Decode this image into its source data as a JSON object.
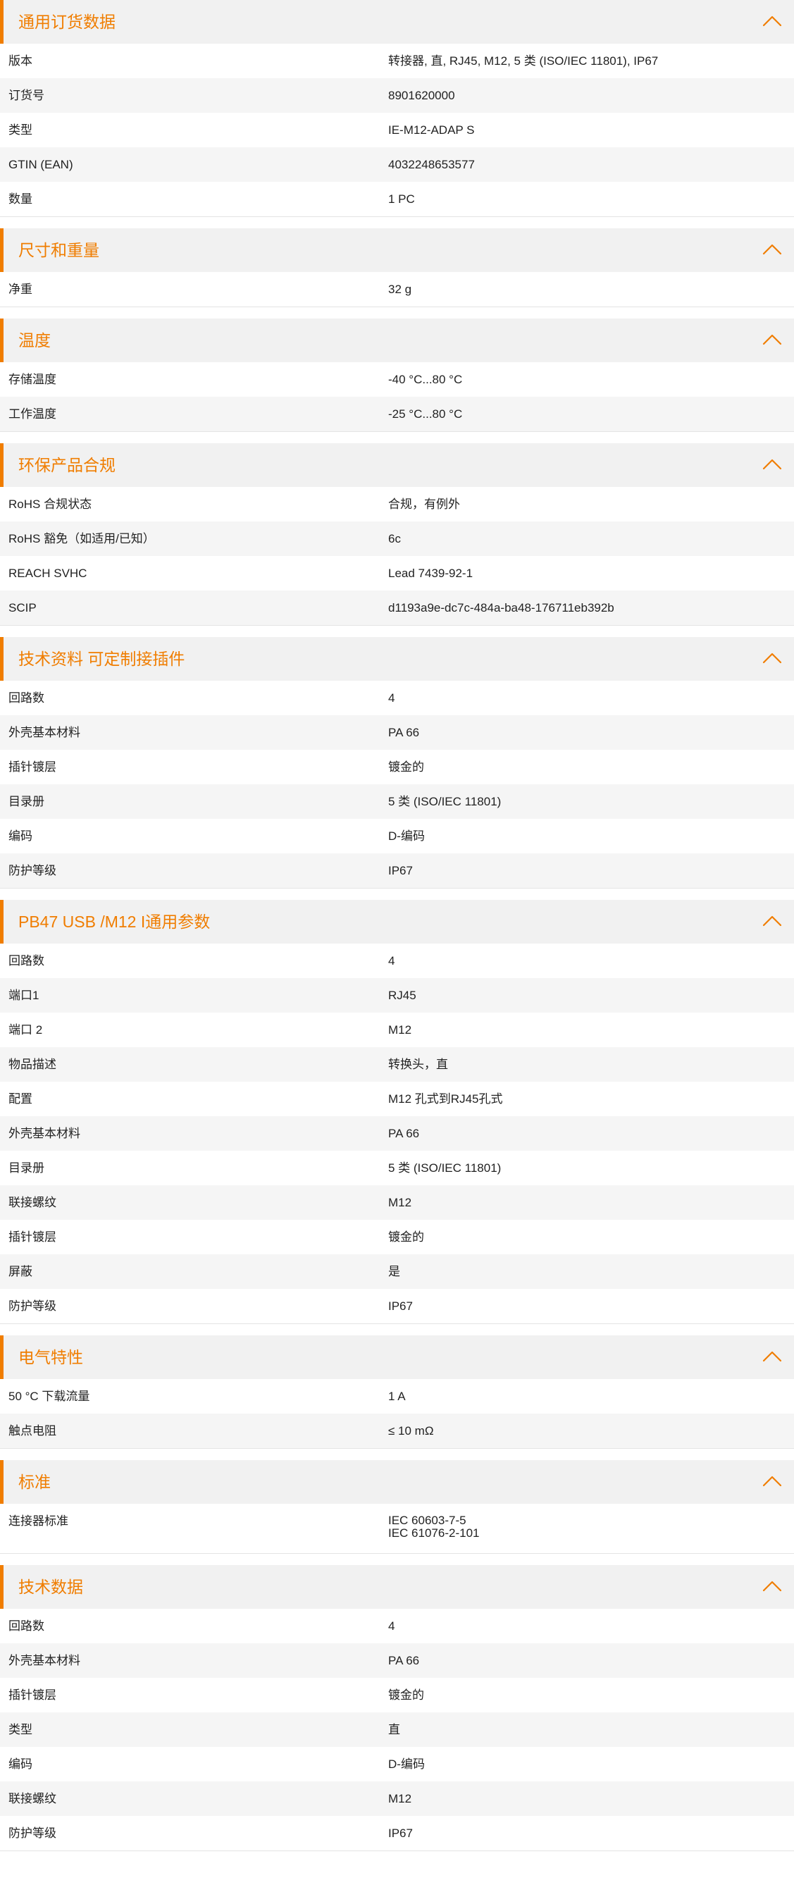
{
  "theme": {
    "accent": "#f07d00",
    "header_bg": "#f1f1f1",
    "row_alt_bg": "#f5f5f5"
  },
  "icons": {
    "collapse": "chevron-up-icon"
  },
  "sections": [
    {
      "title": "通用订货数据",
      "rows": [
        {
          "label": "版本",
          "value": "转接器, 直, RJ45, M12, 5 类 (ISO/IEC 11801), IP67"
        },
        {
          "label": "订货号",
          "value": "8901620000"
        },
        {
          "label": "类型",
          "value": "IE-M12-ADAP S"
        },
        {
          "label": "GTIN (EAN)",
          "value": "4032248653577"
        },
        {
          "label": "数量",
          "value": "1  PC"
        }
      ]
    },
    {
      "title": "尺寸和重量",
      "rows": [
        {
          "label": "净重",
          "value": "32  g"
        }
      ]
    },
    {
      "title": "温度",
      "rows": [
        {
          "label": "存储温度",
          "value": "-40 °C...80 °C"
        },
        {
          "label": "工作温度",
          "value": "-25 °C...80 °C"
        }
      ]
    },
    {
      "title": "环保产品合规",
      "rows": [
        {
          "label": "RoHS 合规状态",
          "value": "合规，有例外"
        },
        {
          "label": "RoHS 豁免（如适用/已知）",
          "value": "6c"
        },
        {
          "label": "REACH SVHC",
          "value": "Lead 7439-92-1"
        },
        {
          "label": "SCIP",
          "value": "d1193a9e-dc7c-484a-ba48-176711eb392b"
        }
      ]
    },
    {
      "title": "技术资料 可定制接插件",
      "rows": [
        {
          "label": "回路数",
          "value": "4"
        },
        {
          "label": "外壳基本材料",
          "value": "PA 66"
        },
        {
          "label": "插针镀层",
          "value": "镀金的"
        },
        {
          "label": "目录册",
          "value": "5 类 (ISO/IEC 11801)"
        },
        {
          "label": "编码",
          "value": "D-编码"
        },
        {
          "label": "防护等级",
          "value": "IP67"
        }
      ]
    },
    {
      "title": "PB47 USB /M12 I通用参数",
      "rows": [
        {
          "label": "回路数",
          "value": "4"
        },
        {
          "label": "端口1",
          "value": "RJ45"
        },
        {
          "label": "端口 2",
          "value": "M12"
        },
        {
          "label": "物品描述",
          "value": "转换头，直"
        },
        {
          "label": "配置",
          "value": "M12 孔式到RJ45孔式"
        },
        {
          "label": "外壳基本材料",
          "value": "PA 66"
        },
        {
          "label": "目录册",
          "value": "5 类 (ISO/IEC 11801)"
        },
        {
          "label": "联接螺纹",
          "value": "M12"
        },
        {
          "label": "插针镀层",
          "value": "镀金的"
        },
        {
          "label": "屏蔽",
          "value": "是"
        },
        {
          "label": "防护等级",
          "value": "IP67"
        }
      ]
    },
    {
      "title": "电气特性",
      "rows": [
        {
          "label": "50 °C 下载流量",
          "value": "1  A"
        },
        {
          "label": "触点电阻",
          "value": "≤ 10 mΩ"
        }
      ]
    },
    {
      "title": "标准",
      "rows": [
        {
          "label": "连接器标准",
          "values": [
            "IEC 60603-7-5",
            "IEC 61076-2-101"
          ]
        }
      ]
    },
    {
      "title": "技术数据",
      "rows": [
        {
          "label": "回路数",
          "value": "4"
        },
        {
          "label": "外壳基本材料",
          "value": "PA 66"
        },
        {
          "label": "插针镀层",
          "value": "镀金的"
        },
        {
          "label": "类型",
          "value": "直"
        },
        {
          "label": "编码",
          "value": "D-编码"
        },
        {
          "label": "联接螺纹",
          "value": "M12"
        },
        {
          "label": "防护等级",
          "value": "IP67"
        }
      ]
    }
  ]
}
